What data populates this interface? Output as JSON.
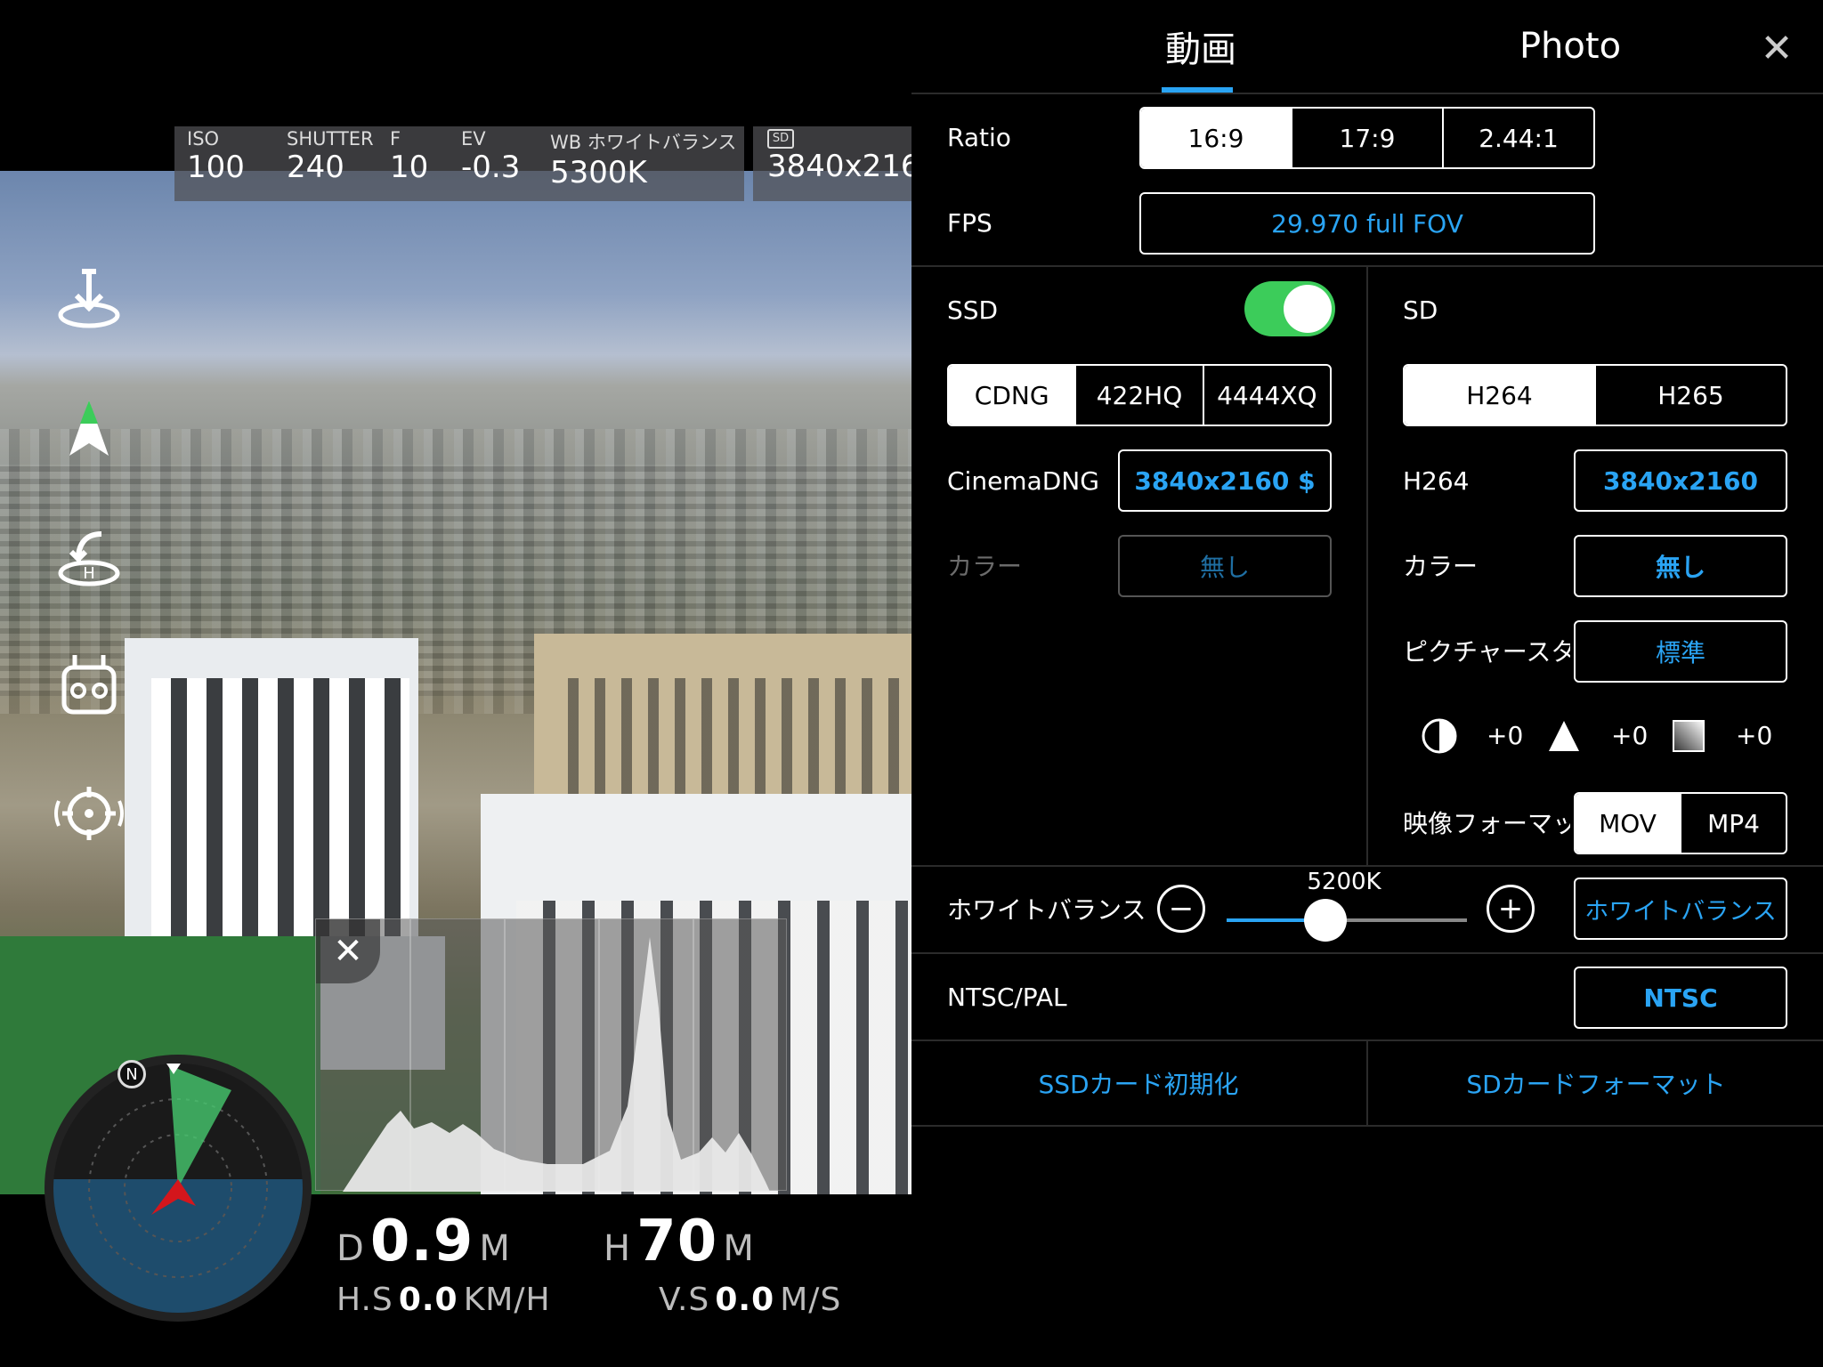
{
  "camera": {
    "params": [
      {
        "label": "ISO",
        "value": "100"
      },
      {
        "label": "SHUTTER",
        "value": "240"
      },
      {
        "label": "F",
        "value": "10"
      },
      {
        "label": "EV",
        "value": "-0.3"
      },
      {
        "label": "WB ホワイトバランス",
        "value": "5300K"
      }
    ],
    "storage_icon": "SD",
    "resolution": "3840x216"
  },
  "sidebar_icons": [
    "download-icon",
    "navigation-arrow-icon",
    "return-home-icon",
    "remote-controller-icon",
    "focus-target-icon"
  ],
  "radar": {
    "north_label": "N"
  },
  "telemetry": {
    "d_label": "D",
    "d_value": "0.9",
    "d_unit": "M",
    "h_label": "H",
    "h_value": "70",
    "h_unit": "M",
    "hs_label": "H.S",
    "hs_value": "0.0",
    "hs_unit": "KM/H",
    "vs_label": "V.S",
    "vs_value": "0.0",
    "vs_unit": "M/S"
  },
  "panel": {
    "tabs": {
      "video": "動画",
      "photo": "Photo",
      "active": "video"
    },
    "ratio": {
      "label": "Ratio",
      "options": [
        "16:9",
        "17:9",
        "2.44:1"
      ],
      "selected": "16:9"
    },
    "fps": {
      "label": "FPS",
      "value": "29.970 full FOV"
    },
    "ssd": {
      "label": "SSD",
      "enabled": true,
      "codecs": [
        "CDNG",
        "422HQ",
        "4444XQ"
      ],
      "selected": "CDNG",
      "format_label": "CinemaDNG",
      "format_value": "3840x2160 $",
      "color_label": "カラー",
      "color_value": "無し"
    },
    "sd": {
      "label": "SD",
      "codecs": [
        "H264",
        "H265"
      ],
      "selected": "H264",
      "format_label": "H264",
      "format_value": "3840x2160",
      "color_label": "カラー",
      "color_value": "無し",
      "style_label": "ピクチャースタイル",
      "style_value": "標準",
      "adjust": [
        {
          "icon": "contrast-icon",
          "value": "+0"
        },
        {
          "icon": "sharpness-icon",
          "value": "+0"
        },
        {
          "icon": "saturation-icon",
          "value": "+0"
        }
      ],
      "container_label": "映像フォーマット",
      "containers": [
        "MOV",
        "MP4"
      ],
      "container_selected": "MOV"
    },
    "white_balance": {
      "label": "ホワイトバランス",
      "value": "5200K",
      "level": 0.41,
      "button": "ホワイトバランス"
    },
    "ntsc_pal": {
      "label": "NTSC/PAL",
      "value": "NTSC"
    },
    "actions": {
      "ssd_format": "SSDカード初期化",
      "sd_format": "SDカードフォーマット"
    },
    "close_icon": "close-icon"
  }
}
